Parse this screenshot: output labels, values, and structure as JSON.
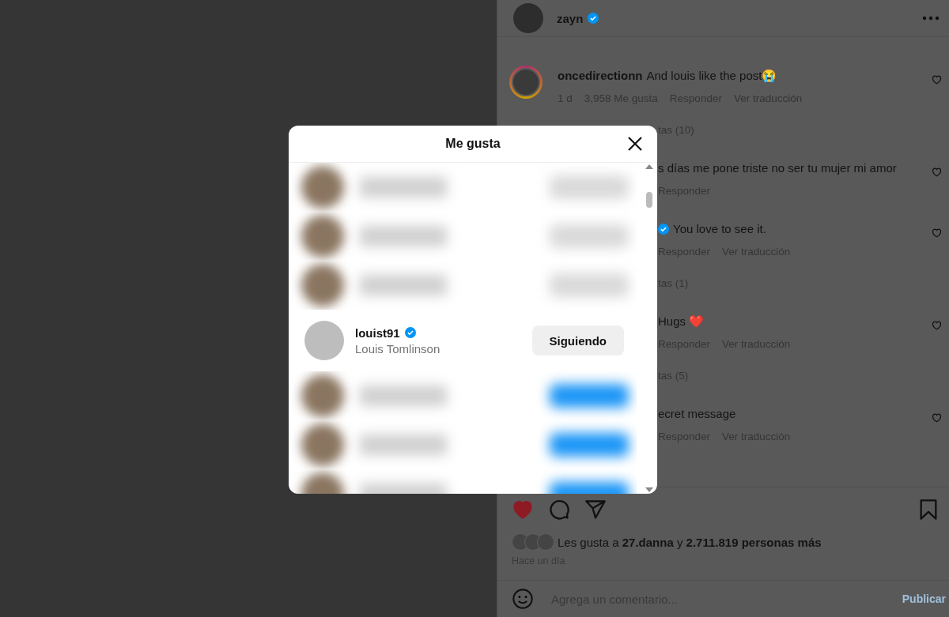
{
  "post_header": {
    "username": "zayn",
    "verified": true
  },
  "comments": [
    {
      "kind": "full",
      "username": "oncedirectionn",
      "text": "And louis like the post😭",
      "meta": [
        "1 d",
        "3,958 Me gusta",
        "Responder",
        "Ver traducción"
      ]
    },
    {
      "kind": "replies",
      "text": "tas (10)"
    },
    {
      "kind": "partial",
      "verified": false,
      "text": "s días me pone triste no ser tu mujer mi amor",
      "meta": [
        "Responder"
      ]
    },
    {
      "kind": "partial",
      "verified": true,
      "text": "You love to see it.",
      "meta": [
        "Responder",
        "Ver traducción"
      ]
    },
    {
      "kind": "replies",
      "text": "tas (1)"
    },
    {
      "kind": "partial",
      "verified": false,
      "text": "Hugs ❤️",
      "meta": [
        "Responder",
        "Ver traducción"
      ]
    },
    {
      "kind": "replies",
      "text": "tas (5)"
    },
    {
      "kind": "partial",
      "verified": false,
      "text": "ecret message",
      "meta": [
        "Responder",
        "Ver traducción"
      ]
    }
  ],
  "actions": {
    "liked": true
  },
  "likes": {
    "text": "Les gusta a **27.danna** y **2.711.819 personas más**",
    "time": "Hace un día"
  },
  "comment_field": {
    "placeholder": "Agrega un comentario...",
    "submit": "Publicar",
    "disabled": true
  },
  "likes_dialog": {
    "title": "Me gusta",
    "rows": [
      {
        "kind": "blurred",
        "following": true
      },
      {
        "kind": "blurred",
        "following": true
      },
      {
        "kind": "blurred",
        "following": true
      },
      {
        "kind": "user",
        "username": "louist91",
        "verified": true,
        "full_name": "Louis Tomlinson",
        "button": "Siguiendo",
        "following": true
      },
      {
        "kind": "blurred",
        "following": false
      },
      {
        "kind": "blurred",
        "following": false
      },
      {
        "kind": "blurred",
        "following": false
      }
    ]
  }
}
